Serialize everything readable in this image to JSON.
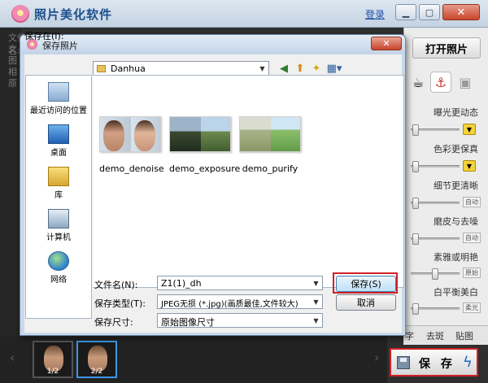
{
  "app": {
    "title": "照片美化软件",
    "login": "登录",
    "left_sidebar_text": [
      "文件名:1.jpg",
      "文",
      "图",
      "相",
      "原"
    ],
    "open_photo": "打开照片",
    "adjustments": [
      {
        "label": "曝光更动态",
        "control": "dropdown",
        "level": 0.1
      },
      {
        "label": "色彩更保真",
        "control": "dropdown",
        "level": 0.1
      },
      {
        "label": "细节更清晰",
        "control": "auto",
        "button": "自动",
        "level": 0.1
      },
      {
        "label": "磨皮与去噪",
        "control": "auto",
        "button": "自动",
        "level": 0.1
      },
      {
        "label": "素雅或明艳",
        "control": "mode",
        "button": "原始",
        "level": 0.5
      },
      {
        "label": "白平衡美白",
        "control": "mode",
        "button": "柔光",
        "level": 0.1
      }
    ],
    "bottom_tabs": [
      "字",
      "去斑",
      "贴图"
    ],
    "thumbnails": [
      {
        "count": "1/2",
        "active": false
      },
      {
        "count": "2/2",
        "active": true
      }
    ],
    "save_button": "保 存"
  },
  "dialog": {
    "title": "保存照片",
    "save_in_label": "保存在(I):",
    "save_in_value": "Danhua",
    "places": [
      "最近访问的位置",
      "桌面",
      "库",
      "计算机",
      "网络"
    ],
    "files": [
      "demo_denoise",
      "demo_exposure",
      "demo_purify"
    ],
    "filename_label": "文件名(N):",
    "filename_value": "Z1(1)_dh",
    "filetype_label": "保存类型(T):",
    "filetype_value": "JPEG无损 (*.jpg)(画质最佳,文件较大)",
    "size_label": "保存尺寸:",
    "size_value": "原始图像尺寸",
    "save_button": "保存(S)",
    "cancel_button": "取消"
  }
}
